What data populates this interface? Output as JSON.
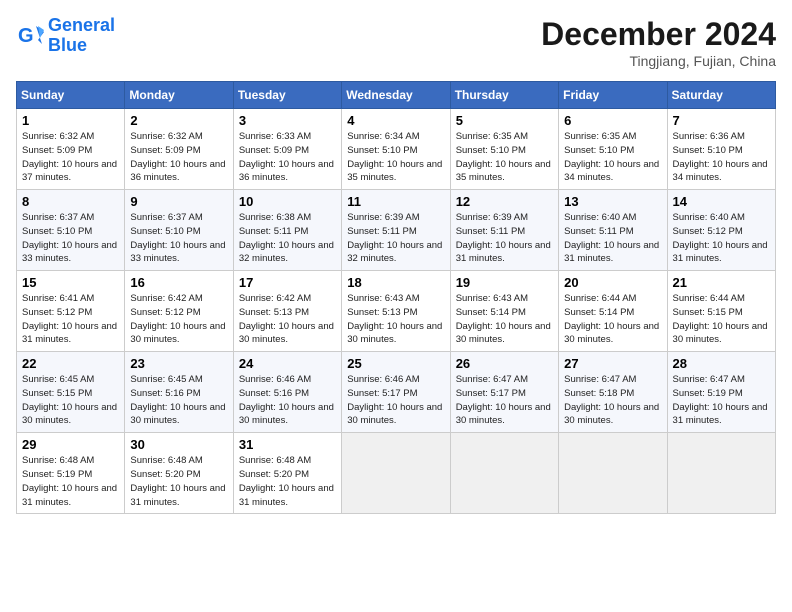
{
  "logo": {
    "line1": "General",
    "line2": "Blue"
  },
  "title": "December 2024",
  "location": "Tingjiang, Fujian, China",
  "weekdays": [
    "Sunday",
    "Monday",
    "Tuesday",
    "Wednesday",
    "Thursday",
    "Friday",
    "Saturday"
  ],
  "weeks": [
    [
      {
        "day": "1",
        "sunrise": "Sunrise: 6:32 AM",
        "sunset": "Sunset: 5:09 PM",
        "daylight": "Daylight: 10 hours and 37 minutes."
      },
      {
        "day": "2",
        "sunrise": "Sunrise: 6:32 AM",
        "sunset": "Sunset: 5:09 PM",
        "daylight": "Daylight: 10 hours and 36 minutes."
      },
      {
        "day": "3",
        "sunrise": "Sunrise: 6:33 AM",
        "sunset": "Sunset: 5:09 PM",
        "daylight": "Daylight: 10 hours and 36 minutes."
      },
      {
        "day": "4",
        "sunrise": "Sunrise: 6:34 AM",
        "sunset": "Sunset: 5:10 PM",
        "daylight": "Daylight: 10 hours and 35 minutes."
      },
      {
        "day": "5",
        "sunrise": "Sunrise: 6:35 AM",
        "sunset": "Sunset: 5:10 PM",
        "daylight": "Daylight: 10 hours and 35 minutes."
      },
      {
        "day": "6",
        "sunrise": "Sunrise: 6:35 AM",
        "sunset": "Sunset: 5:10 PM",
        "daylight": "Daylight: 10 hours and 34 minutes."
      },
      {
        "day": "7",
        "sunrise": "Sunrise: 6:36 AM",
        "sunset": "Sunset: 5:10 PM",
        "daylight": "Daylight: 10 hours and 34 minutes."
      }
    ],
    [
      {
        "day": "8",
        "sunrise": "Sunrise: 6:37 AM",
        "sunset": "Sunset: 5:10 PM",
        "daylight": "Daylight: 10 hours and 33 minutes."
      },
      {
        "day": "9",
        "sunrise": "Sunrise: 6:37 AM",
        "sunset": "Sunset: 5:10 PM",
        "daylight": "Daylight: 10 hours and 33 minutes."
      },
      {
        "day": "10",
        "sunrise": "Sunrise: 6:38 AM",
        "sunset": "Sunset: 5:11 PM",
        "daylight": "Daylight: 10 hours and 32 minutes."
      },
      {
        "day": "11",
        "sunrise": "Sunrise: 6:39 AM",
        "sunset": "Sunset: 5:11 PM",
        "daylight": "Daylight: 10 hours and 32 minutes."
      },
      {
        "day": "12",
        "sunrise": "Sunrise: 6:39 AM",
        "sunset": "Sunset: 5:11 PM",
        "daylight": "Daylight: 10 hours and 31 minutes."
      },
      {
        "day": "13",
        "sunrise": "Sunrise: 6:40 AM",
        "sunset": "Sunset: 5:11 PM",
        "daylight": "Daylight: 10 hours and 31 minutes."
      },
      {
        "day": "14",
        "sunrise": "Sunrise: 6:40 AM",
        "sunset": "Sunset: 5:12 PM",
        "daylight": "Daylight: 10 hours and 31 minutes."
      }
    ],
    [
      {
        "day": "15",
        "sunrise": "Sunrise: 6:41 AM",
        "sunset": "Sunset: 5:12 PM",
        "daylight": "Daylight: 10 hours and 31 minutes."
      },
      {
        "day": "16",
        "sunrise": "Sunrise: 6:42 AM",
        "sunset": "Sunset: 5:12 PM",
        "daylight": "Daylight: 10 hours and 30 minutes."
      },
      {
        "day": "17",
        "sunrise": "Sunrise: 6:42 AM",
        "sunset": "Sunset: 5:13 PM",
        "daylight": "Daylight: 10 hours and 30 minutes."
      },
      {
        "day": "18",
        "sunrise": "Sunrise: 6:43 AM",
        "sunset": "Sunset: 5:13 PM",
        "daylight": "Daylight: 10 hours and 30 minutes."
      },
      {
        "day": "19",
        "sunrise": "Sunrise: 6:43 AM",
        "sunset": "Sunset: 5:14 PM",
        "daylight": "Daylight: 10 hours and 30 minutes."
      },
      {
        "day": "20",
        "sunrise": "Sunrise: 6:44 AM",
        "sunset": "Sunset: 5:14 PM",
        "daylight": "Daylight: 10 hours and 30 minutes."
      },
      {
        "day": "21",
        "sunrise": "Sunrise: 6:44 AM",
        "sunset": "Sunset: 5:15 PM",
        "daylight": "Daylight: 10 hours and 30 minutes."
      }
    ],
    [
      {
        "day": "22",
        "sunrise": "Sunrise: 6:45 AM",
        "sunset": "Sunset: 5:15 PM",
        "daylight": "Daylight: 10 hours and 30 minutes."
      },
      {
        "day": "23",
        "sunrise": "Sunrise: 6:45 AM",
        "sunset": "Sunset: 5:16 PM",
        "daylight": "Daylight: 10 hours and 30 minutes."
      },
      {
        "day": "24",
        "sunrise": "Sunrise: 6:46 AM",
        "sunset": "Sunset: 5:16 PM",
        "daylight": "Daylight: 10 hours and 30 minutes."
      },
      {
        "day": "25",
        "sunrise": "Sunrise: 6:46 AM",
        "sunset": "Sunset: 5:17 PM",
        "daylight": "Daylight: 10 hours and 30 minutes."
      },
      {
        "day": "26",
        "sunrise": "Sunrise: 6:47 AM",
        "sunset": "Sunset: 5:17 PM",
        "daylight": "Daylight: 10 hours and 30 minutes."
      },
      {
        "day": "27",
        "sunrise": "Sunrise: 6:47 AM",
        "sunset": "Sunset: 5:18 PM",
        "daylight": "Daylight: 10 hours and 30 minutes."
      },
      {
        "day": "28",
        "sunrise": "Sunrise: 6:47 AM",
        "sunset": "Sunset: 5:19 PM",
        "daylight": "Daylight: 10 hours and 31 minutes."
      }
    ],
    [
      {
        "day": "29",
        "sunrise": "Sunrise: 6:48 AM",
        "sunset": "Sunset: 5:19 PM",
        "daylight": "Daylight: 10 hours and 31 minutes."
      },
      {
        "day": "30",
        "sunrise": "Sunrise: 6:48 AM",
        "sunset": "Sunset: 5:20 PM",
        "daylight": "Daylight: 10 hours and 31 minutes."
      },
      {
        "day": "31",
        "sunrise": "Sunrise: 6:48 AM",
        "sunset": "Sunset: 5:20 PM",
        "daylight": "Daylight: 10 hours and 31 minutes."
      },
      null,
      null,
      null,
      null
    ]
  ]
}
